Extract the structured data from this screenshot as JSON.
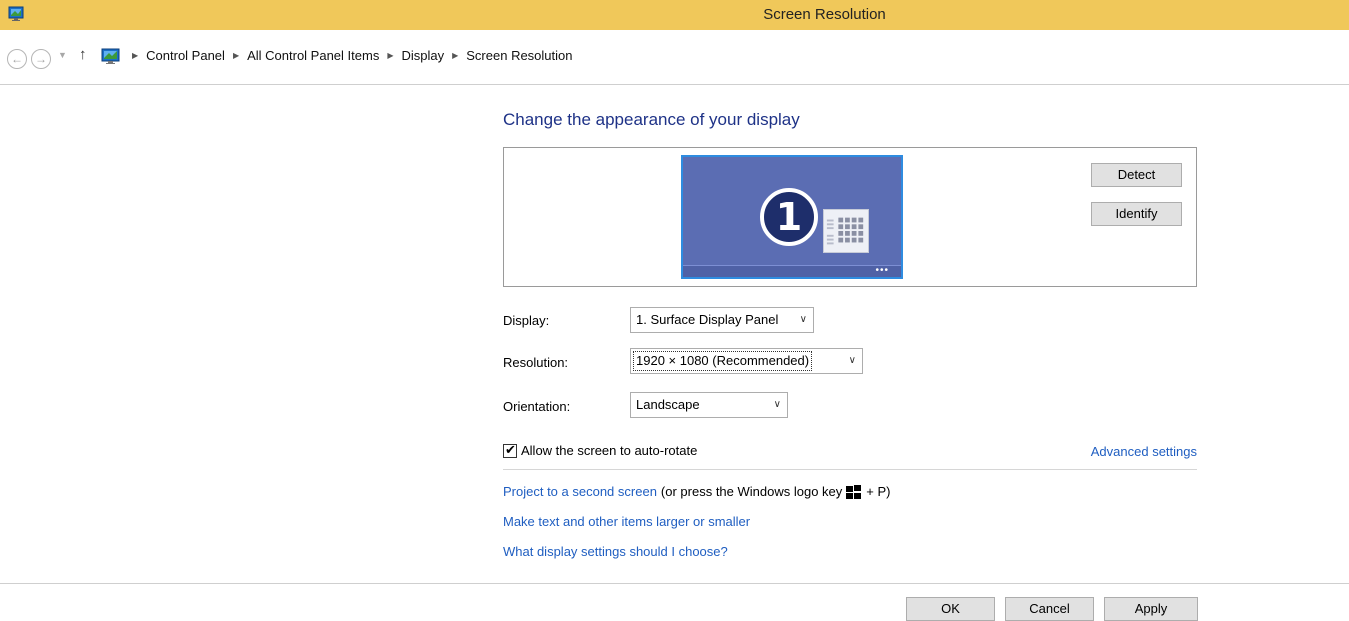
{
  "window": {
    "title": "Screen Resolution",
    "titlebar_color": "#f0c85a"
  },
  "nav": {
    "back_icon": "back-arrow-icon",
    "forward_icon": "forward-arrow-icon",
    "recent_icon": "chevron-down-icon",
    "up_icon": "up-arrow-icon",
    "up_glyph": "↑",
    "back_glyph": "←",
    "forward_glyph": "→",
    "recent_glyph": "▼"
  },
  "breadcrumb": [
    "Control Panel",
    "All Control Panel Items",
    "Display",
    "Screen Resolution"
  ],
  "breadcrumb_sep": "▶",
  "main": {
    "heading": "Change the appearance of your display",
    "monitor_number": "1",
    "monitor_dots": "•••",
    "detect_label": "Detect",
    "identify_label": "Identify",
    "display_label": "Display:",
    "display_value": "1. Surface Display Panel",
    "resolution_label": "Resolution:",
    "resolution_value": "1920 × 1080 (Recommended)",
    "orientation_label": "Orientation:",
    "orientation_value": "Landscape",
    "caret_glyph": "∨",
    "autorotate_label": "Allow the screen to auto-rotate",
    "autorotate_checked": true,
    "checkmark_glyph": "✔",
    "advanced_link": "Advanced settings",
    "project_link": "Project to a second screen",
    "project_hint_before": "(or press the Windows logo key",
    "project_hint_after": "+ P)",
    "larger_link": "Make text and other items larger or smaller",
    "choose_link": "What display settings should I choose?"
  },
  "footer": {
    "ok_label": "OK",
    "cancel_label": "Cancel",
    "apply_label": "Apply"
  },
  "colors": {
    "heading": "#1e3287",
    "link": "#1f5ec1",
    "monitor_bg": "#5b6db3",
    "monitor_border": "#2e8ce0"
  }
}
